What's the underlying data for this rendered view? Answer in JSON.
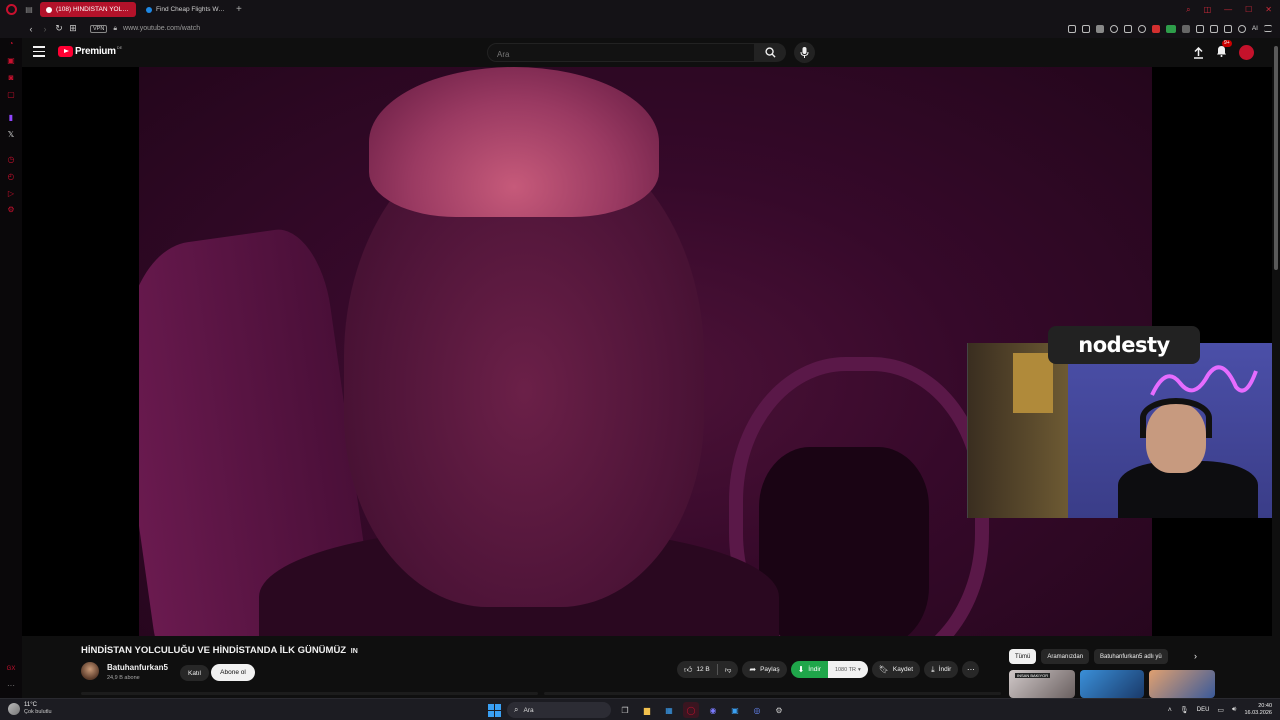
{
  "browser": {
    "tabs": [
      {
        "title": "(108) HİNDİSTAN YOLCUL",
        "active": true,
        "favicon_color": "#ff0033"
      },
      {
        "title": "Find Cheap Flights Worldw",
        "active": false,
        "favicon_color": "#1e88e5"
      }
    ],
    "new_tab_label": "+",
    "url": "www.youtube.com/watch",
    "vpn_label": "VPN",
    "ai_label": "AI"
  },
  "youtube": {
    "logo_text": "Premium",
    "logo_country": "DE",
    "search_placeholder": "Ara",
    "notification_badge": "9+",
    "video": {
      "title": "HİNDİSTAN YOLCULUĞU VE HİNDİSTANDA İLK GÜNÜMÜZ",
      "title_suffix": "IN",
      "channel_name": "Batuhanfurkan5",
      "subscribers": "24,9 B abone",
      "join_label": "Katıl",
      "subscribe_label": "Abone ol",
      "likes": "12 B",
      "share_label": "Paylaş",
      "download_label": "İndir",
      "download_quality": "1080 TR",
      "save_label": "Kaydet",
      "download2_label": "İndir"
    },
    "chips": [
      "Tümü",
      "Aramanızdan",
      "Batuhanfurkan5 adlı yü"
    ],
    "thumbnail_caption": "INSAN BAKIYOR"
  },
  "overlay": {
    "streamer_logo": "nodesty"
  },
  "taskbar": {
    "weather_temp": "11°C",
    "weather_desc": "Çok bulutlu",
    "search_placeholder": "Ara",
    "language": "DEU",
    "time": "20:40",
    "date": "16.03.2026"
  },
  "colors": {
    "accent": "#c8102e",
    "youtube_red": "#ff0033",
    "download_green": "#1fa64a"
  }
}
